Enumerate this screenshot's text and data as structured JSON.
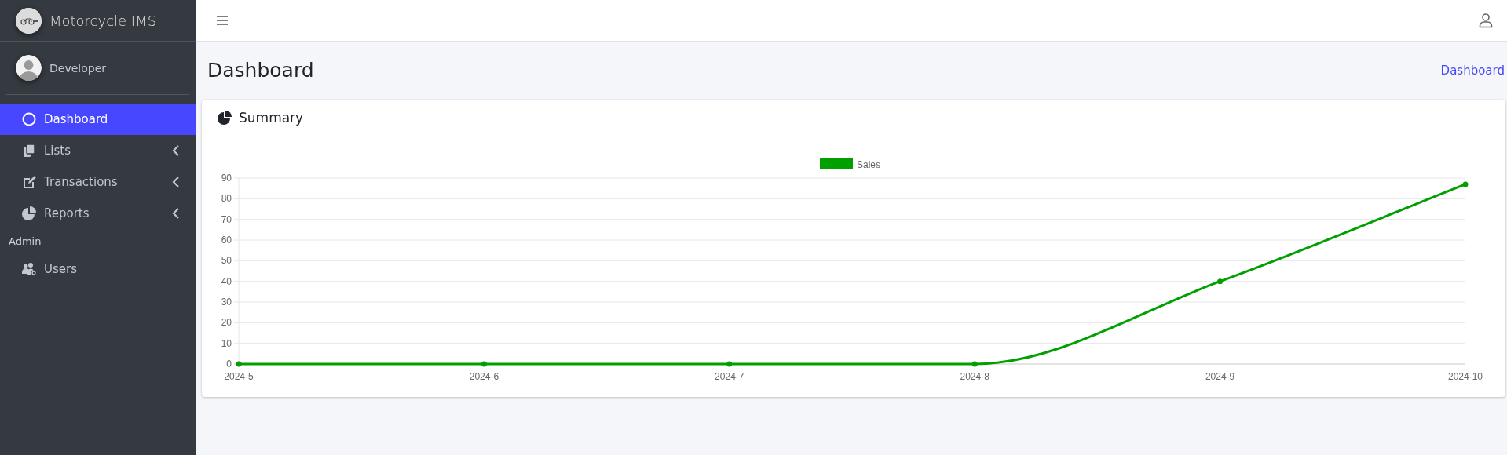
{
  "brand": {
    "title": "Motorcycle IMS"
  },
  "user": {
    "name": "Developer"
  },
  "nav": [
    {
      "kind": "link",
      "label": "Dashboard",
      "selected": true
    },
    {
      "kind": "menu",
      "label": "Lists",
      "selected": false
    },
    {
      "kind": "menu",
      "label": "Transactions",
      "selected": false
    },
    {
      "kind": "menu",
      "label": "Reports",
      "selected": false
    },
    {
      "kind": "header",
      "label": "Admin"
    },
    {
      "kind": "link",
      "label": "Users",
      "selected": false
    }
  ],
  "page": {
    "title": "Dashboard",
    "breadcrumb": "Dashboard"
  },
  "card": {
    "title": "Summary",
    "chart_data": {
      "type": "line",
      "categories": [
        "2024-5",
        "2024-6",
        "2024-7",
        "2024-8",
        "2024-9",
        "2024-10"
      ],
      "series": [
        {
          "name": "Sales",
          "color": "#00a000",
          "marker": true,
          "values": [
            0,
            0,
            0,
            0,
            40,
            87
          ]
        }
      ],
      "grid": true,
      "ylim": [
        0,
        90
      ],
      "yticks": [
        0,
        10,
        20,
        30,
        40,
        50,
        60,
        70,
        80,
        90
      ]
    }
  }
}
